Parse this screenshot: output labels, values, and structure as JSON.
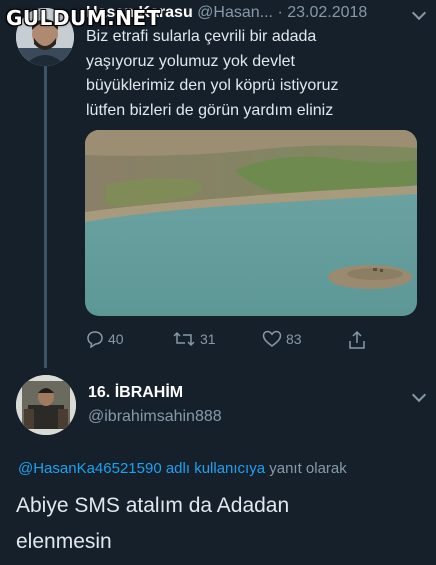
{
  "watermark": "GULDUM.NET",
  "tweet1": {
    "name": "Hasan Karasu",
    "handle": "@Hasan...",
    "date": "· 23.02.2018",
    "lines": [
      "Biz etrafi sularla çevrili bir adada",
      "yaşıyoruz yolumuz yok devlet",
      "büyüklerimiz den yol köprü istiyoruz",
      "lütfen bizleri de görün yardım eliniz"
    ],
    "reply_count": "40",
    "retweet_count": "31",
    "like_count": "83"
  },
  "tweet2": {
    "name": "16. İBRAHİM",
    "handle": "@ibrahimsahin888",
    "reply_mention": "@HasanKa46521590 adlı kullanıcıya",
    "reply_suffix": " yanıt olarak",
    "lines": [
      "Abiye SMS atalım da Adadan",
      "elenmesin"
    ]
  },
  "icons": {
    "reply": "reply-icon",
    "retweet": "retweet-icon",
    "like": "heart-icon",
    "share": "share-icon",
    "more": "chevron-down-icon"
  },
  "colors": {
    "background": "#15202b",
    "accent": "#1da1f2",
    "muted": "#8899a6"
  }
}
